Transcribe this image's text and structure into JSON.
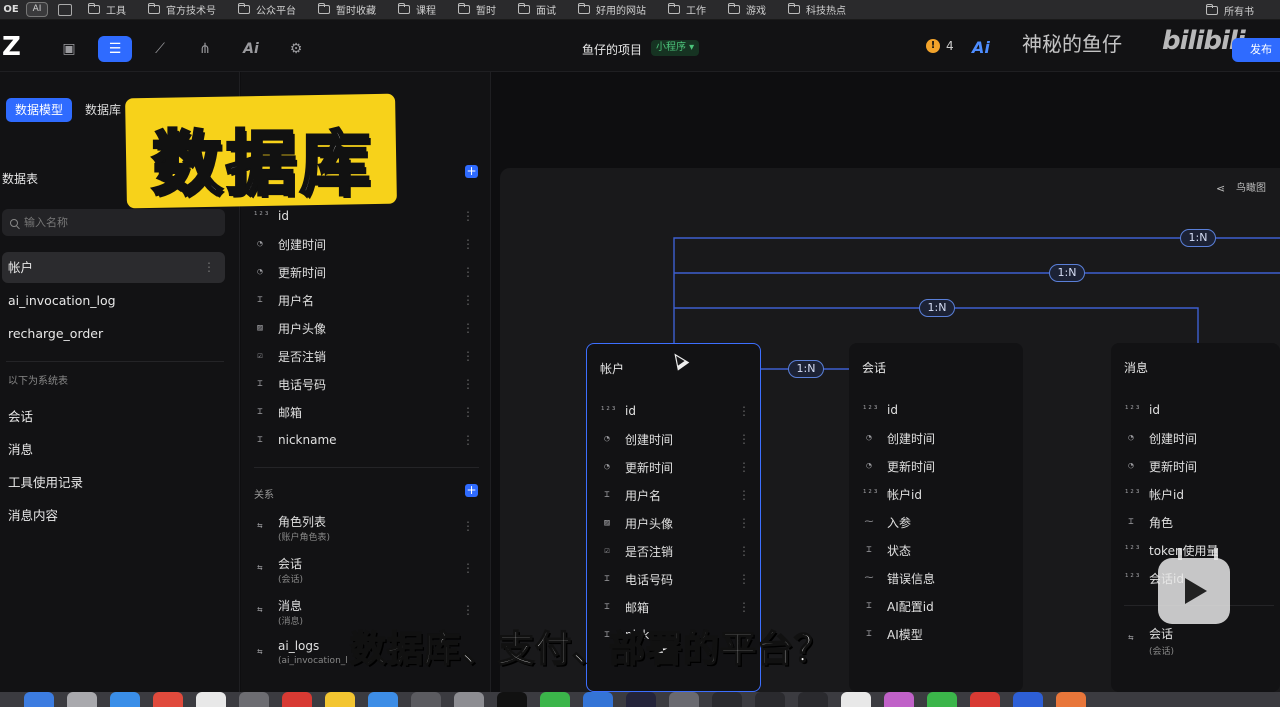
{
  "bookmarks": {
    "oe": "OE",
    "ai": "AI",
    "items": [
      "工具",
      "官方技术号",
      "公众平台",
      "暂时收藏",
      "课程",
      "暂时",
      "面试",
      "好用的网站",
      "工作",
      "游戏",
      "科技热点"
    ],
    "right": "所有书"
  },
  "header": {
    "logo": "Z",
    "project_name": "鱼仔的项目",
    "project_type": "小程序",
    "warning_count": "4",
    "ai_label": "Ai",
    "publish_label": "发布",
    "watermark": "神秘的鱼仔",
    "bili_logo": "bilibili"
  },
  "sidebar": {
    "tabs": [
      "数据模型",
      "数据库"
    ],
    "section_title": "数据表",
    "search_placeholder": "输入名称",
    "tables": [
      "帐户",
      "ai_invocation_log",
      "recharge_order"
    ],
    "system_label": "以下为系统表",
    "system_tables": [
      "会话",
      "消息",
      "工具使用记录",
      "消息内容"
    ]
  },
  "overlay": {
    "title": "数据库"
  },
  "fields_panel": {
    "fields": [
      {
        "icon": "123",
        "name": "id"
      },
      {
        "icon": "clock",
        "name": "创建时间"
      },
      {
        "icon": "clock",
        "name": "更新时间"
      },
      {
        "icon": "text",
        "name": "用户名"
      },
      {
        "icon": "image",
        "name": "用户头像"
      },
      {
        "icon": "check",
        "name": "是否注销"
      },
      {
        "icon": "text",
        "name": "电话号码"
      },
      {
        "icon": "text",
        "name": "邮箱"
      },
      {
        "icon": "text",
        "name": "nickname"
      }
    ],
    "relations_title": "关系",
    "relations": [
      {
        "name": "角色列表",
        "sub": "(账户角色表)"
      },
      {
        "name": "会话",
        "sub": "(会话)"
      },
      {
        "name": "消息",
        "sub": "(消息)"
      },
      {
        "name": "ai_logs",
        "sub": "(ai_invocation_l"
      }
    ]
  },
  "canvas": {
    "birdseye_label": "鸟瞰图",
    "relation_badges": [
      "1:N",
      "1:N",
      "1:N",
      "1:N"
    ],
    "cards": [
      {
        "title": "帐户",
        "fields": [
          "id",
          "创建时间",
          "更新时间",
          "用户名",
          "用户头像",
          "是否注销",
          "电话号码",
          "邮箱",
          "nicknam"
        ]
      },
      {
        "title": "会话",
        "fields": [
          "id",
          "创建时间",
          "更新时间",
          "帐户id",
          "入参",
          "状态",
          "错误信息",
          "AI配置id",
          "AI模型"
        ]
      },
      {
        "title": "消息",
        "fields": [
          "id",
          "创建时间",
          "更新时间",
          "帐户id",
          "角色",
          "token使用量",
          "会话id"
        ],
        "relation": {
          "name": "会话",
          "sub": "(会话)"
        }
      }
    ]
  },
  "subtitle": "数据库、支付、部署的平台？"
}
